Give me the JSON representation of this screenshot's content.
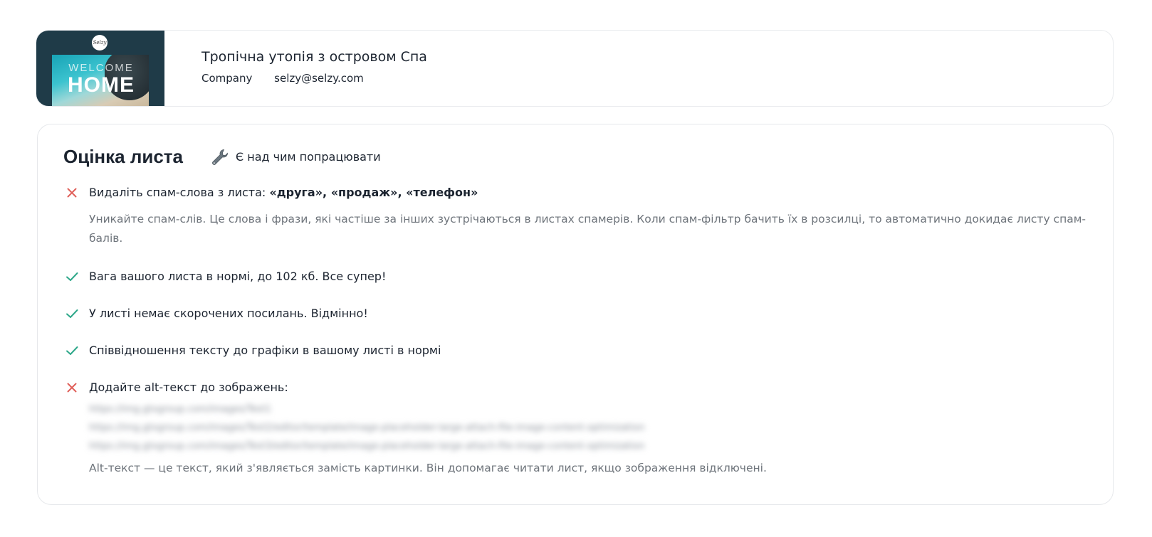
{
  "header": {
    "title": "Тропічна утопія з островом Спа",
    "sender_name": "Company",
    "sender_email": "selzy@selzy.com",
    "thumbnail": {
      "logo_text": "Selzy",
      "welcome_text": "WELCOME",
      "home_text": "HOME"
    }
  },
  "score": {
    "title": "Оцінка листа",
    "status_icon": "wrench-icon",
    "status_text": "Є над чим попрацювати",
    "colors": {
      "error": "#e0605a",
      "ok": "#2fa88a"
    },
    "items": [
      {
        "status": "error",
        "title_prefix": "Видаліть спам-слова з листа: ",
        "title_bold": "«друга», «продаж», «телефон»",
        "description": "Уникайте спам-слів. Це слова і фрази, які частіше за інших зустрічаються в листах спамерів. Коли спам-фільтр бачить їх в розсилці, то автоматично докидає листу спам-балів."
      },
      {
        "status": "ok",
        "title": "Вага вашого листа в нормі, до 102 кб. Все супер!"
      },
      {
        "status": "ok",
        "title": "У листі немає скорочених посилань. Відмінно!"
      },
      {
        "status": "ok",
        "title": "Співвідношення тексту до графіки в вашому листі в нормі"
      },
      {
        "status": "error",
        "title": "Додайте alt-текст до зображень:",
        "blurred_links": [
          "https://img.gtxgroup.com/images/Test1",
          "https://img.gtxgroup.com/images/Test2/editor/template/image-placeholder-large-attach-file-image-content-optimization",
          "https://img.gtxgroup.com/images/Test3/editor/template/image-placeholder-large-attach-file-image-content-optimization"
        ],
        "description": "Alt-текст — це текст, який з'являється замість картинки. Він допомагає читати лист, якщо зображення відключені."
      }
    ]
  }
}
